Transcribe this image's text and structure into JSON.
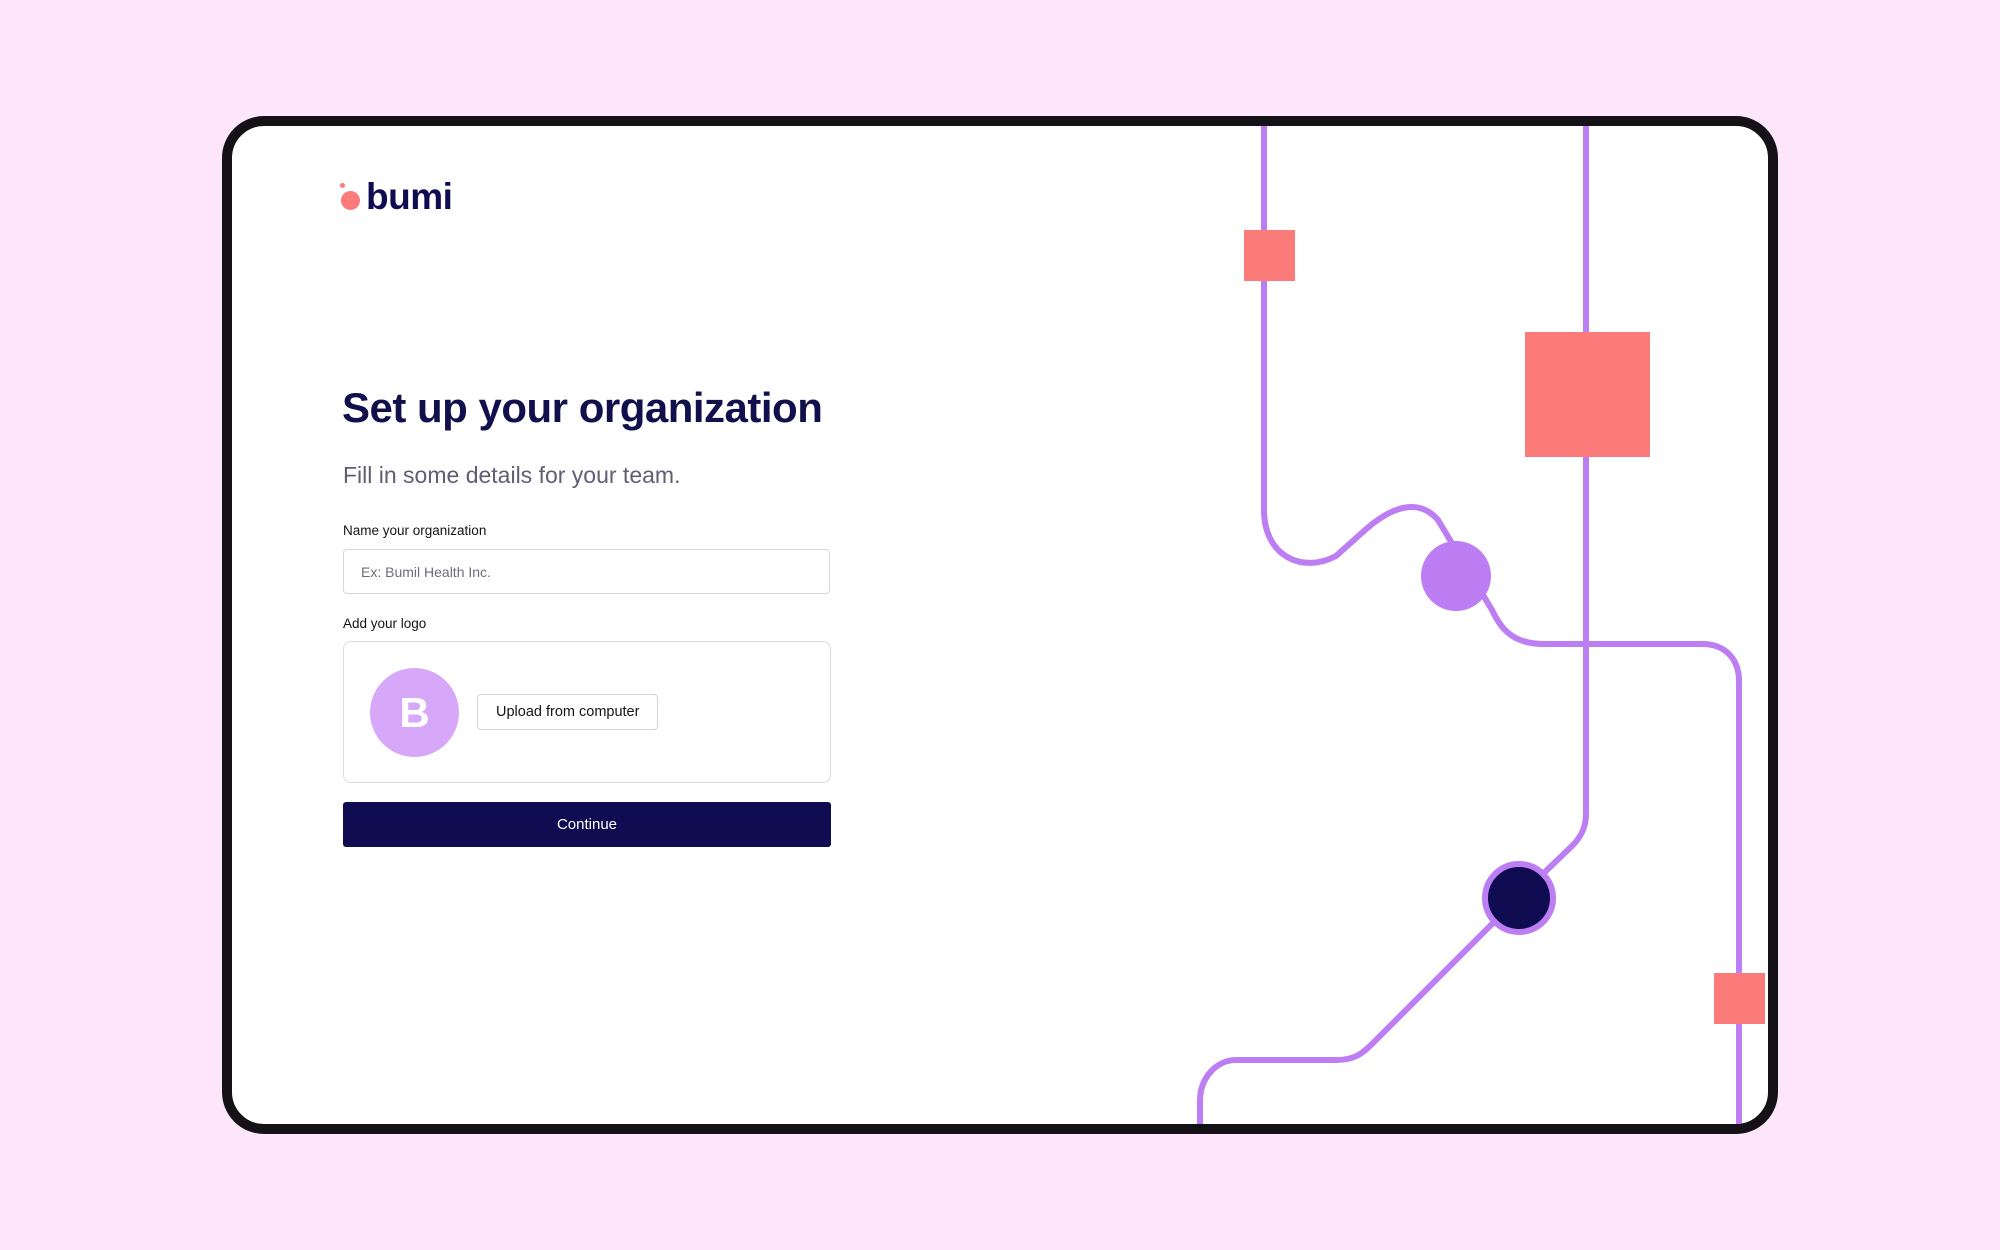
{
  "brand": {
    "name": "bumi"
  },
  "page": {
    "title": "Set up your organization",
    "subtitle": "Fill in some details for your team."
  },
  "form": {
    "org_name_label": "Name your organization",
    "org_name_placeholder": "Ex: Bumil Health Inc.",
    "org_name_value": "",
    "logo_label": "Add your logo",
    "avatar_letter": "B",
    "upload_label": "Upload from computer",
    "continue_label": "Continue"
  },
  "colors": {
    "background": "#fde6fb",
    "primary": "#0f0c52",
    "accent_coral": "#fb7b7b",
    "accent_purple": "#bd7df3",
    "avatar": "#d7a7fa"
  },
  "icons": {
    "brand_mark": "two-dot-logo-icon"
  }
}
